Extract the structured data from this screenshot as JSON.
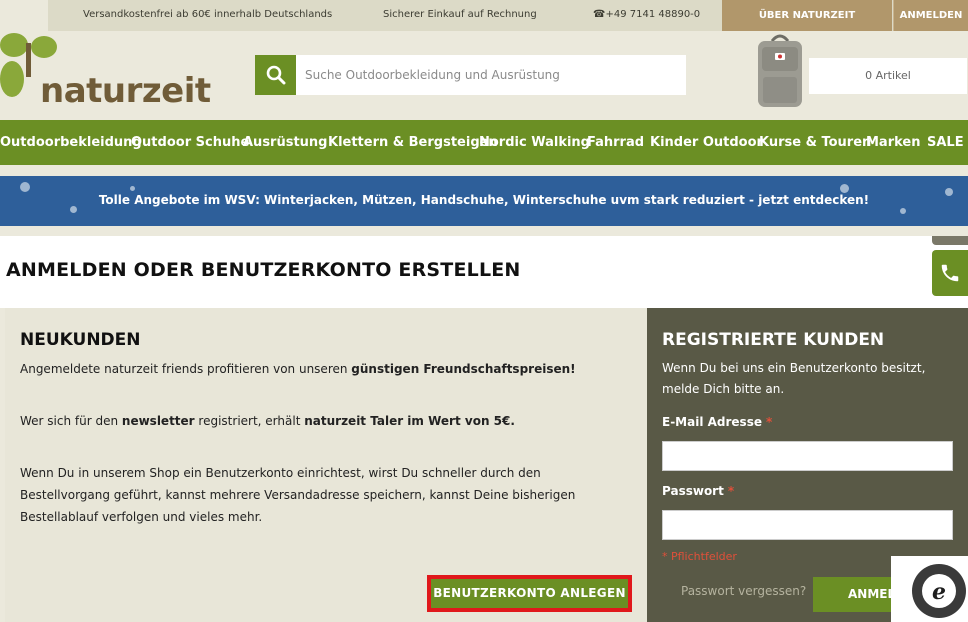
{
  "topbar": {
    "shipping": "Versandkostenfrei ab 60€ innerhalb Deutschlands",
    "secure": "Sicherer Einkauf auf Rechnung",
    "phone": "☎+49 7141 48890-0",
    "about": "ÜBER NATURZEIT",
    "login": "ANMELDEN"
  },
  "header": {
    "logo_text": "naturzeit",
    "search_placeholder": "Suche Outdoorbekleidung und Ausrüstung",
    "cart": "0 Artikel"
  },
  "nav": {
    "items": [
      "Outdoorbekleidung",
      "Outdoor Schuhe",
      "Ausrüstung",
      "Klettern & Bergsteigen",
      "Nordic Walking",
      "Fahrrad",
      "Kinder Outdoor",
      "Kurse & Touren",
      "Marken",
      "SALE"
    ]
  },
  "banner": {
    "text": "Tolle Angebote im WSV: Winterjacken, Mützen, Handschuhe, Winterschuhe uvm stark reduziert - jetzt entdecken!"
  },
  "page": {
    "title": "ANMELDEN ODER BENUTZERKONTO ERSTELLEN"
  },
  "new_customers": {
    "heading": "NEUKUNDEN",
    "p1_a": "Angemeldete naturzeit friends profitieren von unseren ",
    "p1_b": "günstigen Freundschaftspreisen!",
    "p2_a": "Wer sich für den ",
    "p2_b": "newsletter",
    "p2_c": " registriert, erhält ",
    "p2_d": "naturzeit Taler im Wert von 5€.",
    "p3": "Wenn Du in unserem Shop ein Benutzerkonto einrichtest, wirst Du schneller durch den Bestellvorgang geführt, kannst mehrere Versandadresse speichern, kannst Deine bisherigen Bestellablauf verfolgen und vieles mehr.",
    "button": "BENUTZERKONTO ANLEGEN"
  },
  "registered": {
    "heading": "REGISTRIERTE KUNDEN",
    "intro": "Wenn Du bei uns ein Benutzerkonto besitzt, melde Dich bitte an.",
    "email_label": "E-Mail Adresse",
    "password_label": "Passwort",
    "required_star": "*",
    "required_note": "* Pflichtfelder",
    "forgot": "Passwort vergessen?",
    "login_button": "ANMELDEN"
  },
  "colors": {
    "green": "#6b8f24",
    "brown": "#b1976b",
    "dark_panel": "#595946",
    "highlight": "#e0181b"
  }
}
